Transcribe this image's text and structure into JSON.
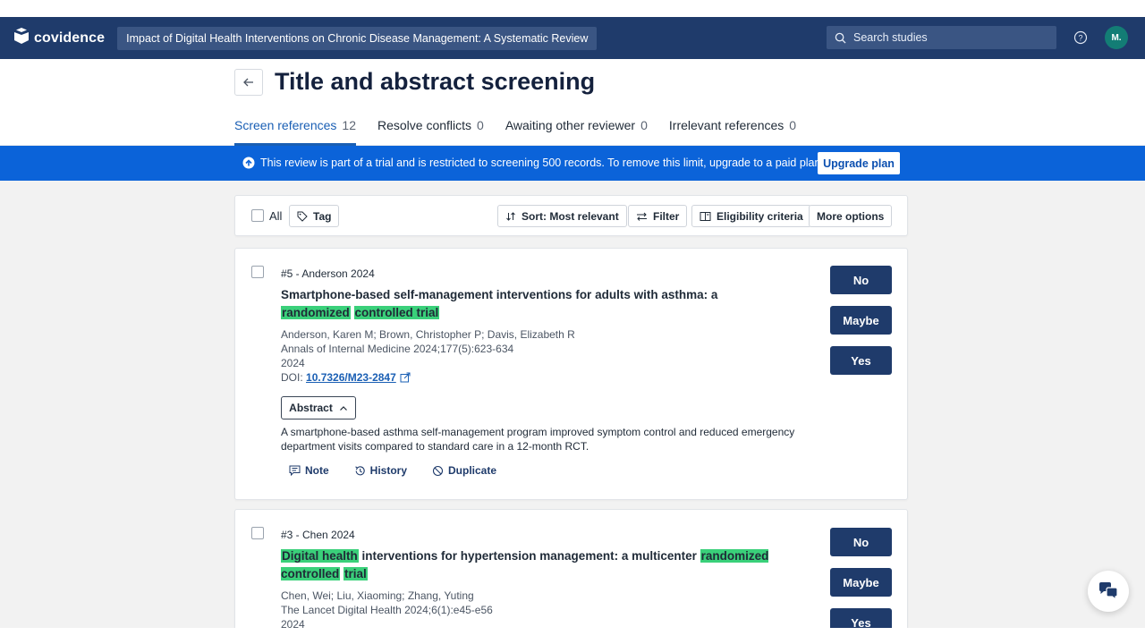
{
  "header": {
    "logo_text": "covidence",
    "review_title": "Impact of Digital Health Interventions on Chronic Disease Management: A Systematic Review",
    "search_placeholder": "Search studies",
    "avatar_initials": "M."
  },
  "page": {
    "title": "Title and abstract screening",
    "tabs": [
      {
        "label": "Screen references",
        "count": "12",
        "active": true
      },
      {
        "label": "Resolve conflicts",
        "count": "0"
      },
      {
        "label": "Awaiting other reviewer",
        "count": "0"
      },
      {
        "label": "Irrelevant references",
        "count": "0"
      }
    ]
  },
  "banner": {
    "text": "This review is part of a trial and is restricted to screening 500 records. To remove this limit, upgrade to a paid plan.",
    "button": "Upgrade plan"
  },
  "toolbar": {
    "all_label": "All",
    "tag_label": "Tag",
    "sort_label": "Sort: Most relevant",
    "filter_label": "Filter",
    "eligibility_label": "Eligibility criteria",
    "more_label": "More options"
  },
  "references": [
    {
      "id_line": "#5 - Anderson 2024",
      "title_parts": [
        "Smartphone-based self-management interventions for adults with asthma: a ",
        "randomized",
        " ",
        "controlled trial"
      ],
      "authors": "Anderson, Karen M; Brown, Christopher P; Davis, Elizabeth R",
      "journal": "Annals of Internal Medicine 2024;177(5):623-634",
      "year": "2024",
      "doi_prefix": "DOI: ",
      "doi": "10.7326/M23-2847",
      "abstract_button": "Abstract",
      "abstract": "A smartphone-based asthma self-management program improved symptom control and reduced emergency department visits compared to standard care in a 12-month RCT.",
      "actions": [
        "Note",
        "History",
        "Duplicate"
      ]
    },
    {
      "id_line": "#3 - Chen 2024",
      "title_parts": [
        "Digital health",
        " interventions for hypertension management: a multicenter ",
        "randomized controlled",
        " ",
        "trial"
      ],
      "authors": "Chen, Wei; Liu, Xiaoming; Zhang, Yuting",
      "journal": "The Lancet Digital Health 2024;6(1):e45-e56",
      "year": "2024"
    }
  ],
  "decision_buttons": {
    "no": "No",
    "maybe": "Maybe",
    "yes": "Yes"
  },
  "colors": {
    "header_bg": "#1f3b6b",
    "banner_bg": "#0b63d9",
    "highlight": "#3ad07a",
    "accent": "#1a5fb4"
  }
}
